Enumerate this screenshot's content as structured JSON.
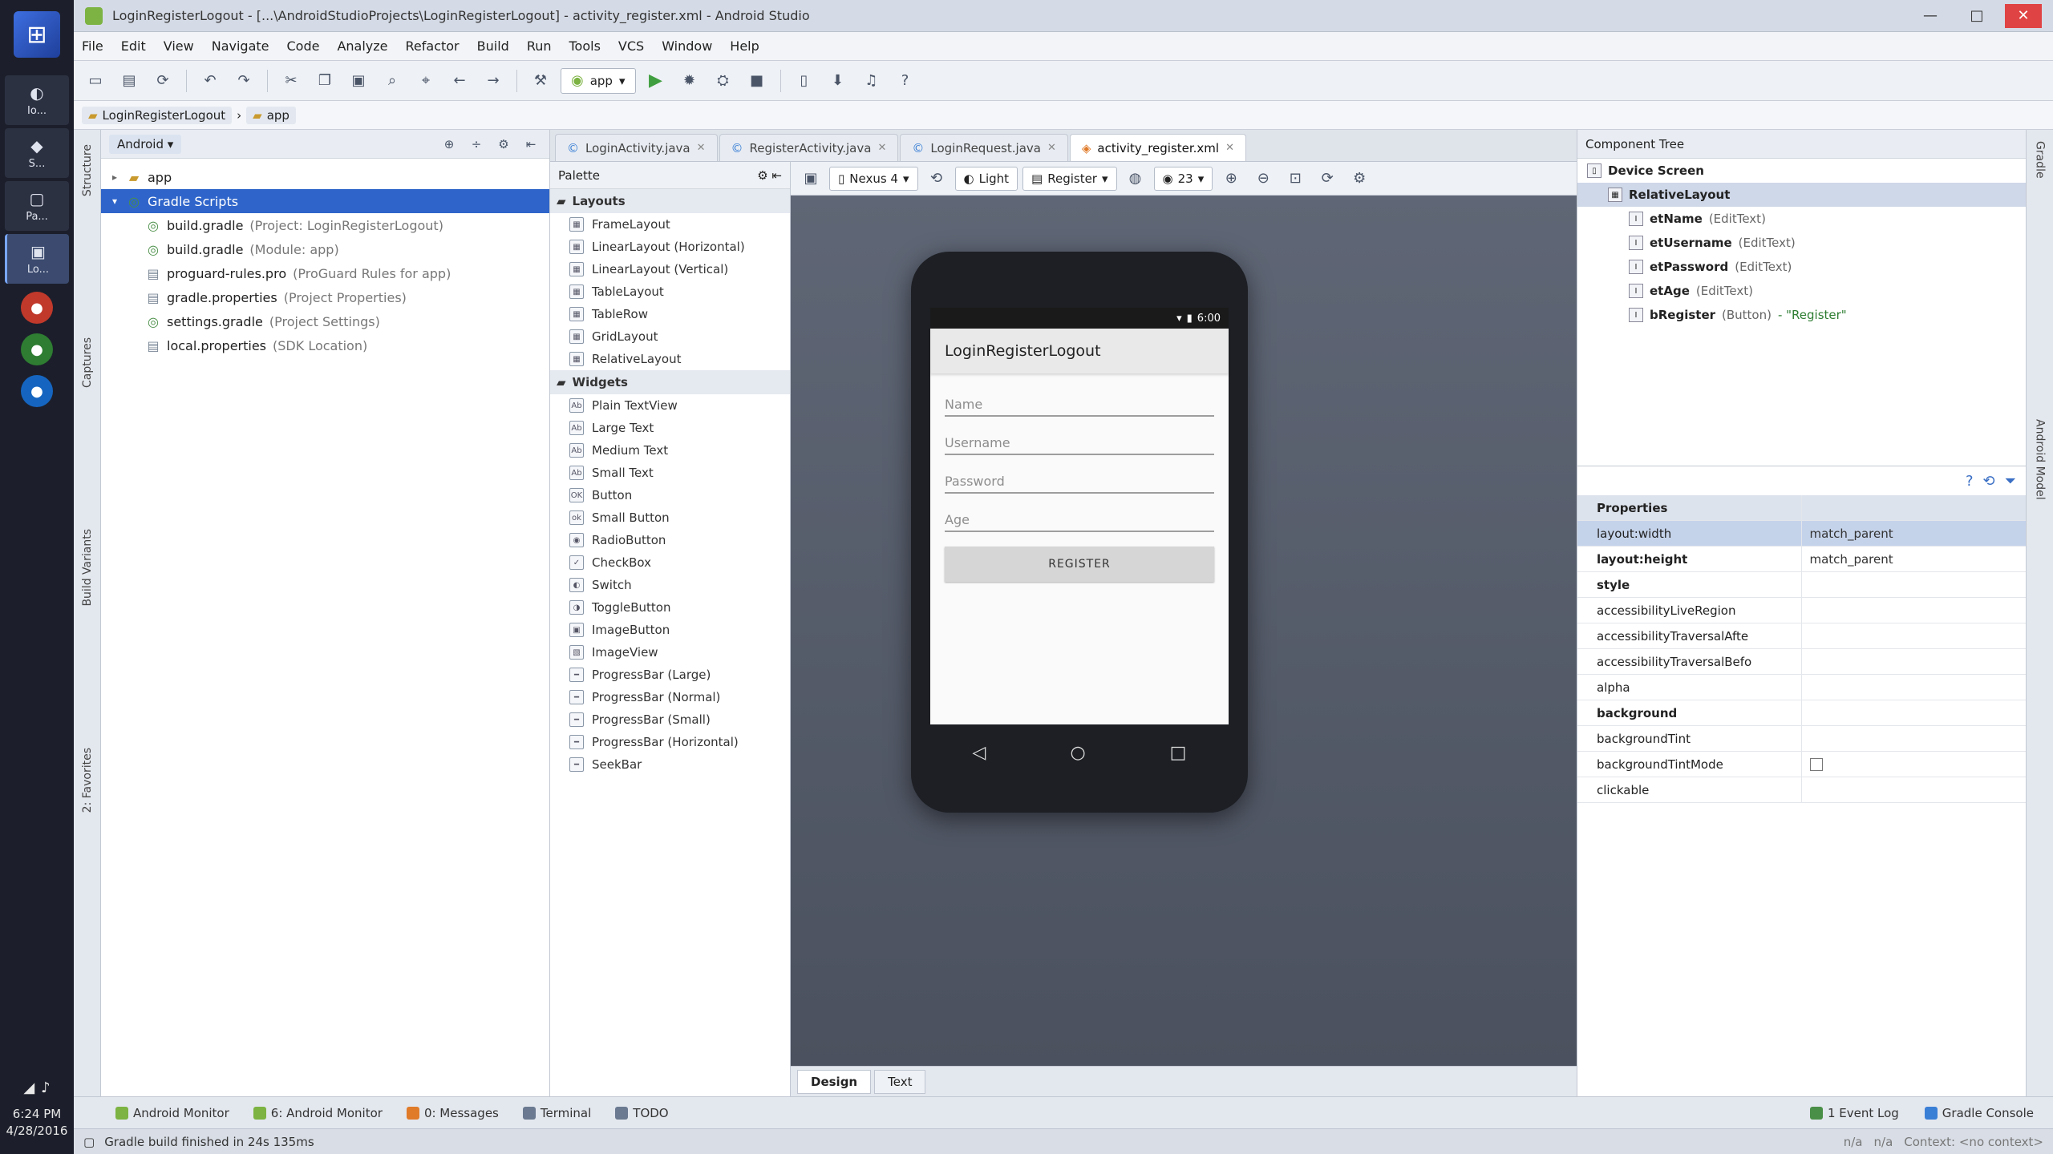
{
  "taskbar": {
    "items": [
      {
        "label": "Io...",
        "glyph": "◐"
      },
      {
        "label": "S...",
        "glyph": "◆"
      },
      {
        "label": "Pa...",
        "glyph": "▢"
      },
      {
        "label": "Lo...",
        "glyph": "▣"
      }
    ],
    "clock_time": "6:24 PM",
    "clock_date": "4/28/2016"
  },
  "titlebar": {
    "title": "LoginRegisterLogout - [...\\AndroidStudioProjects\\LoginRegisterLogout] - activity_register.xml - Android Studio"
  },
  "menu": [
    "File",
    "Edit",
    "View",
    "Navigate",
    "Code",
    "Analyze",
    "Refactor",
    "Build",
    "Run",
    "Tools",
    "VCS",
    "Window",
    "Help"
  ],
  "toolbar": {
    "run_config": "app"
  },
  "navbar": {
    "crumbs": [
      "LoginRegisterLogout",
      "app"
    ]
  },
  "left_strip": {
    "tabs": [
      "Structure",
      "Captures",
      "Build Variants",
      "2: Favorites"
    ]
  },
  "project_panel": {
    "view": "Android",
    "tree": [
      {
        "label": "app",
        "note": "",
        "icon": "folder",
        "indent": 0,
        "arrow": "▸",
        "selected": false
      },
      {
        "label": "Gradle Scripts",
        "note": "",
        "icon": "gradle",
        "indent": 0,
        "arrow": "▾",
        "selected": true
      },
      {
        "label": "build.gradle",
        "note": "(Project: LoginRegisterLogout)",
        "icon": "gradle",
        "indent": 1,
        "arrow": "",
        "selected": false
      },
      {
        "label": "build.gradle",
        "note": "(Module: app)",
        "icon": "gradle",
        "indent": 1,
        "arrow": "",
        "selected": false
      },
      {
        "label": "proguard-rules.pro",
        "note": "(ProGuard Rules for app)",
        "icon": "file",
        "indent": 1,
        "arrow": "",
        "selected": false
      },
      {
        "label": "gradle.properties",
        "note": "(Project Properties)",
        "icon": "file",
        "indent": 1,
        "arrow": "",
        "selected": false
      },
      {
        "label": "settings.gradle",
        "note": "(Project Settings)",
        "icon": "gradle",
        "indent": 1,
        "arrow": "",
        "selected": false
      },
      {
        "label": "local.properties",
        "note": "(SDK Location)",
        "icon": "file",
        "indent": 1,
        "arrow": "",
        "selected": false
      }
    ]
  },
  "editor_tabs": [
    {
      "label": "LoginActivity.java",
      "type": "java",
      "active": false
    },
    {
      "label": "RegisterActivity.java",
      "type": "java",
      "active": false
    },
    {
      "label": "LoginRequest.java",
      "type": "java",
      "active": false
    },
    {
      "label": "activity_register.xml",
      "type": "xml",
      "active": true
    }
  ],
  "palette": {
    "title": "Palette",
    "groups": [
      {
        "name": "Layouts",
        "items": [
          "FrameLayout",
          "LinearLayout (Horizontal)",
          "LinearLayout (Vertical)",
          "TableLayout",
          "TableRow",
          "GridLayout",
          "RelativeLayout"
        ]
      },
      {
        "name": "Widgets",
        "items": [
          "Plain TextView",
          "Large Text",
          "Medium Text",
          "Small Text",
          "Button",
          "Small Button",
          "RadioButton",
          "CheckBox",
          "Switch",
          "ToggleButton",
          "ImageButton",
          "ImageView",
          "ProgressBar (Large)",
          "ProgressBar (Normal)",
          "ProgressBar (Small)",
          "ProgressBar (Horizontal)",
          "SeekBar"
        ]
      }
    ]
  },
  "canvas_toolbar": {
    "device": "Nexus 4",
    "theme": "Light",
    "activity": "Register",
    "api": "23"
  },
  "phone": {
    "status_time": "6:00",
    "app_title": "LoginRegisterLogout",
    "fields": [
      "Name",
      "Username",
      "Password",
      "Age"
    ],
    "button_label": "REGISTER"
  },
  "editor_bottom_tabs": [
    "Design",
    "Text"
  ],
  "component_tree": {
    "title": "Component Tree",
    "rows": [
      {
        "id": "Device Screen",
        "type": "",
        "value": "",
        "indent": 0,
        "selected": false
      },
      {
        "id": "RelativeLayout",
        "type": "",
        "value": "",
        "indent": 1,
        "selected": true
      },
      {
        "id": "etName",
        "type": "(EditText)",
        "value": "",
        "indent": 2,
        "selected": false
      },
      {
        "id": "etUsername",
        "type": "(EditText)",
        "value": "",
        "indent": 2,
        "selected": false
      },
      {
        "id": "etPassword",
        "type": "(EditText)",
        "value": "",
        "indent": 2,
        "selected": false
      },
      {
        "id": "etAge",
        "type": "(EditText)",
        "value": "",
        "indent": 2,
        "selected": false
      },
      {
        "id": "bRegister",
        "type": "(Button)",
        "value": "- \"Register\"",
        "indent": 2,
        "selected": false
      }
    ]
  },
  "properties": {
    "title": "Properties",
    "rows": [
      {
        "name": "layout:width",
        "value": "match_parent",
        "bold": false,
        "selected": true,
        "checkbox": false
      },
      {
        "name": "layout:height",
        "value": "match_parent",
        "bold": true,
        "selected": false,
        "checkbox": false
      },
      {
        "name": "style",
        "value": "",
        "bold": true,
        "selected": false,
        "checkbox": false
      },
      {
        "name": "accessibilityLiveRegion",
        "value": "",
        "bold": false,
        "selected": false,
        "checkbox": false
      },
      {
        "name": "accessibilityTraversalAfte",
        "value": "",
        "bold": false,
        "selected": false,
        "checkbox": false
      },
      {
        "name": "accessibilityTraversalBefo",
        "value": "",
        "bold": false,
        "selected": false,
        "checkbox": false
      },
      {
        "name": "alpha",
        "value": "",
        "bold": false,
        "selected": false,
        "checkbox": false
      },
      {
        "name": "background",
        "value": "",
        "bold": true,
        "selected": false,
        "checkbox": false
      },
      {
        "name": "backgroundTint",
        "value": "",
        "bold": false,
        "selected": false,
        "checkbox": false
      },
      {
        "name": "backgroundTintMode",
        "value": "",
        "bold": false,
        "selected": false,
        "checkbox": true
      },
      {
        "name": "clickable",
        "value": "",
        "bold": false,
        "selected": false,
        "checkbox": false
      }
    ]
  },
  "right_strip": {
    "tabs": [
      "Gradle",
      "Android Model"
    ]
  },
  "bottom_tools": {
    "left": [
      "Android Monitor",
      "6: Android Monitor",
      "0: Messages",
      "Terminal",
      "TODO"
    ],
    "right": [
      "1 Event Log",
      "Gradle Console"
    ]
  },
  "statusbar": {
    "message": "Gradle build finished in 24s 135ms",
    "right": [
      "n/a",
      "n/a",
      "Context: <no context>"
    ]
  }
}
